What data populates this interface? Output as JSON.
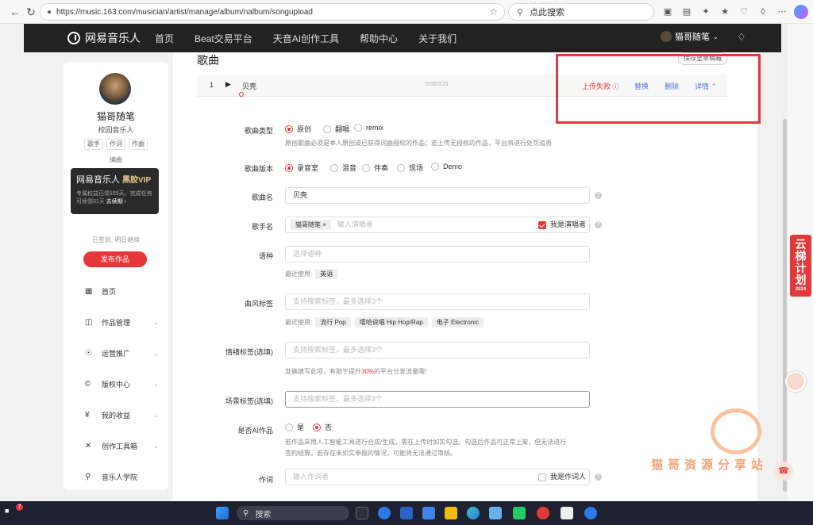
{
  "browser": {
    "url": "https://music.163.com/musician/artist/manage/album/nalbum/songupload",
    "search_placeholder": "点此搜索"
  },
  "nav": {
    "logo": "网易音乐人",
    "links": [
      "首页",
      "Beat交易平台",
      "天音AI创作工具",
      "帮助中心",
      "关于我们"
    ],
    "user": "猫哥随笔"
  },
  "sidebar": {
    "username": "猫哥随笔",
    "role": "校园音乐人",
    "tags": [
      "歌手",
      "作词",
      "作曲"
    ],
    "tag_extra": "编曲",
    "vip": {
      "title": "网易音乐人",
      "badge": "黑胶VIP",
      "desc": "专属权益已领159天，完成任务可续领31天",
      "renew": "去续期"
    },
    "sign_status": "已签到, 明日继续",
    "publish_button": "发布作品",
    "menu": [
      "首页",
      "作品管理",
      "运营推广",
      "版权中心",
      "我的收益",
      "创作工具箱",
      "音乐人学院"
    ]
  },
  "main": {
    "section_title": "歌曲",
    "save_button": "保存至草稿箱",
    "song": {
      "index": "1",
      "name": "贝壳",
      "time": "0:00/3:21",
      "status": "上传失败",
      "replace": "替换",
      "delete": "删除",
      "detail": "详情"
    },
    "form": {
      "song_type_label": "歌曲类型",
      "song_type_options": [
        "原创",
        "翻唱",
        "remix"
      ],
      "song_type_selected": "原创",
      "song_type_note": "原创歌曲必须是本人原创或已获得词曲授权的作品；若上传无授权的作品，平台将进行处罚追责",
      "version_label": "歌曲版本",
      "version_options": [
        "录音室",
        "混音",
        "伴奏",
        "现场",
        "Demo"
      ],
      "version_selected": "录音室",
      "song_name_label": "歌曲名",
      "song_name_value": "贝壳",
      "singer_label": "歌手名",
      "singer_chip": "猫哥随笔",
      "singer_placeholder": "输入演唱者",
      "singer_checkbox": "我是演唱者",
      "language_label": "语种",
      "language_placeholder": "选择语种",
      "recent_label": "最近使用:",
      "language_recent": [
        "英语"
      ],
      "genre_label": "曲风标签",
      "genre_placeholder": "支持搜索标签，最多选择3个",
      "genre_recent": [
        "流行 Pop",
        "嘻哈说唱 Hip Hop/Rap",
        "电子 Electronic"
      ],
      "mood_label": "情绪标签(选填)",
      "mood_placeholder": "支持搜索标签，最多选择3个",
      "mood_note_pre": "准确填写此项，有助于提升",
      "mood_note_pct": "30%",
      "mood_note_post": "的平台分发流量哦!",
      "scene_label": "场景标签(选填)",
      "scene_placeholder": "支持搜索标签，最多选择3个",
      "ai_label": "是否AI作品",
      "ai_options": [
        "是",
        "否"
      ],
      "ai_selected": "否",
      "ai_note_1": "若作品采用人工智能工具进行合成/生成，需在上传时如实勾选。勾选后作品可正常上架，但无法进行",
      "ai_note_2": "签约结算。若存在未如实申报的情况，可能将无法通过审核。",
      "lyricist_label": "作词",
      "lyricist_placeholder": "输入作词者",
      "lyricist_checkbox": "我是作词人"
    }
  },
  "floating": {
    "badge_text": "云梯计划",
    "badge_sub": "2024",
    "watermark": "猫哥资源分享站"
  },
  "taskbar": {
    "search_label": "搜索",
    "notification_count": "7"
  },
  "colors": {
    "accent": "#e8353a",
    "link": "#4a7bd0",
    "nav_bg": "#222222",
    "highlight_box": "#e0393e"
  }
}
